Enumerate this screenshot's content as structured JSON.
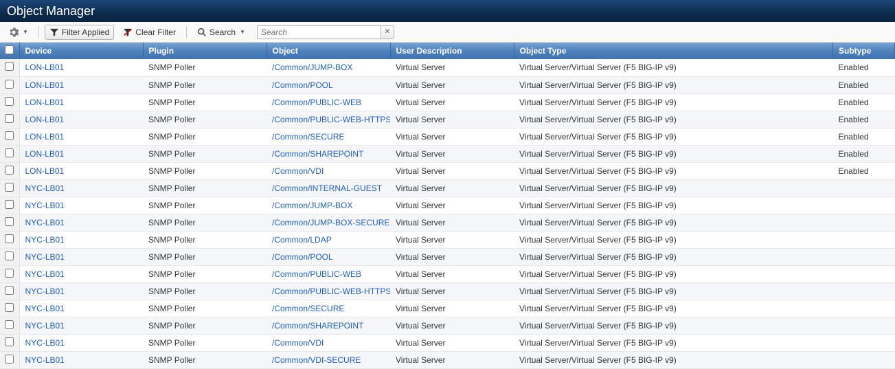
{
  "header": {
    "title": "Object Manager"
  },
  "toolbar": {
    "settings_label": "",
    "filter_applied": "Filter Applied",
    "clear_filter": "Clear Filter",
    "search_label": "Search",
    "search_placeholder": "Search",
    "search_value": "",
    "clear_x": "✕"
  },
  "columns": {
    "device": "Device",
    "plugin": "Plugin",
    "object": "Object",
    "user_description": "User Description",
    "object_type": "Object Type",
    "subtype": "Subtype"
  },
  "rows": [
    {
      "device": "LON-LB01",
      "plugin": "SNMP Poller",
      "object": "/Common/JUMP-BOX",
      "user_description": "Virtual Server",
      "object_type": "Virtual Server/Virtual Server (F5 BIG-IP v9)",
      "subtype": "Enabled"
    },
    {
      "device": "LON-LB01",
      "plugin": "SNMP Poller",
      "object": "/Common/POOL",
      "user_description": "Virtual Server",
      "object_type": "Virtual Server/Virtual Server (F5 BIG-IP v9)",
      "subtype": "Enabled"
    },
    {
      "device": "LON-LB01",
      "plugin": "SNMP Poller",
      "object": "/Common/PUBLIC-WEB",
      "user_description": "Virtual Server",
      "object_type": "Virtual Server/Virtual Server (F5 BIG-IP v9)",
      "subtype": "Enabled"
    },
    {
      "device": "LON-LB01",
      "plugin": "SNMP Poller",
      "object": "/Common/PUBLIC-WEB-HTTPS",
      "user_description": "Virtual Server",
      "object_type": "Virtual Server/Virtual Server (F5 BIG-IP v9)",
      "subtype": "Enabled"
    },
    {
      "device": "LON-LB01",
      "plugin": "SNMP Poller",
      "object": "/Common/SECURE",
      "user_description": "Virtual Server",
      "object_type": "Virtual Server/Virtual Server (F5 BIG-IP v9)",
      "subtype": "Enabled"
    },
    {
      "device": "LON-LB01",
      "plugin": "SNMP Poller",
      "object": "/Common/SHAREPOINT",
      "user_description": "Virtual Server",
      "object_type": "Virtual Server/Virtual Server (F5 BIG-IP v9)",
      "subtype": "Enabled"
    },
    {
      "device": "LON-LB01",
      "plugin": "SNMP Poller",
      "object": "/Common/VDI",
      "user_description": "Virtual Server",
      "object_type": "Virtual Server/Virtual Server (F5 BIG-IP v9)",
      "subtype": "Enabled"
    },
    {
      "device": "NYC-LB01",
      "plugin": "SNMP Poller",
      "object": "/Common/INTERNAL-GUEST",
      "user_description": "Virtual Server",
      "object_type": "Virtual Server/Virtual Server (F5 BIG-IP v9)",
      "subtype": ""
    },
    {
      "device": "NYC-LB01",
      "plugin": "SNMP Poller",
      "object": "/Common/JUMP-BOX",
      "user_description": "Virtual Server",
      "object_type": "Virtual Server/Virtual Server (F5 BIG-IP v9)",
      "subtype": ""
    },
    {
      "device": "NYC-LB01",
      "plugin": "SNMP Poller",
      "object": "/Common/JUMP-BOX-SECURE",
      "user_description": "Virtual Server",
      "object_type": "Virtual Server/Virtual Server (F5 BIG-IP v9)",
      "subtype": ""
    },
    {
      "device": "NYC-LB01",
      "plugin": "SNMP Poller",
      "object": "/Common/LDAP",
      "user_description": "Virtual Server",
      "object_type": "Virtual Server/Virtual Server (F5 BIG-IP v9)",
      "subtype": ""
    },
    {
      "device": "NYC-LB01",
      "plugin": "SNMP Poller",
      "object": "/Common/POOL",
      "user_description": "Virtual Server",
      "object_type": "Virtual Server/Virtual Server (F5 BIG-IP v9)",
      "subtype": ""
    },
    {
      "device": "NYC-LB01",
      "plugin": "SNMP Poller",
      "object": "/Common/PUBLIC-WEB",
      "user_description": "Virtual Server",
      "object_type": "Virtual Server/Virtual Server (F5 BIG-IP v9)",
      "subtype": ""
    },
    {
      "device": "NYC-LB01",
      "plugin": "SNMP Poller",
      "object": "/Common/PUBLIC-WEB-HTTPS",
      "user_description": "Virtual Server",
      "object_type": "Virtual Server/Virtual Server (F5 BIG-IP v9)",
      "subtype": ""
    },
    {
      "device": "NYC-LB01",
      "plugin": "SNMP Poller",
      "object": "/Common/SECURE",
      "user_description": "Virtual Server",
      "object_type": "Virtual Server/Virtual Server (F5 BIG-IP v9)",
      "subtype": ""
    },
    {
      "device": "NYC-LB01",
      "plugin": "SNMP Poller",
      "object": "/Common/SHAREPOINT",
      "user_description": "Virtual Server",
      "object_type": "Virtual Server/Virtual Server (F5 BIG-IP v9)",
      "subtype": ""
    },
    {
      "device": "NYC-LB01",
      "plugin": "SNMP Poller",
      "object": "/Common/VDI",
      "user_description": "Virtual Server",
      "object_type": "Virtual Server/Virtual Server (F5 BIG-IP v9)",
      "subtype": ""
    },
    {
      "device": "NYC-LB01",
      "plugin": "SNMP Poller",
      "object": "/Common/VDI-SECURE",
      "user_description": "Virtual Server",
      "object_type": "Virtual Server/Virtual Server (F5 BIG-IP v9)",
      "subtype": ""
    }
  ]
}
